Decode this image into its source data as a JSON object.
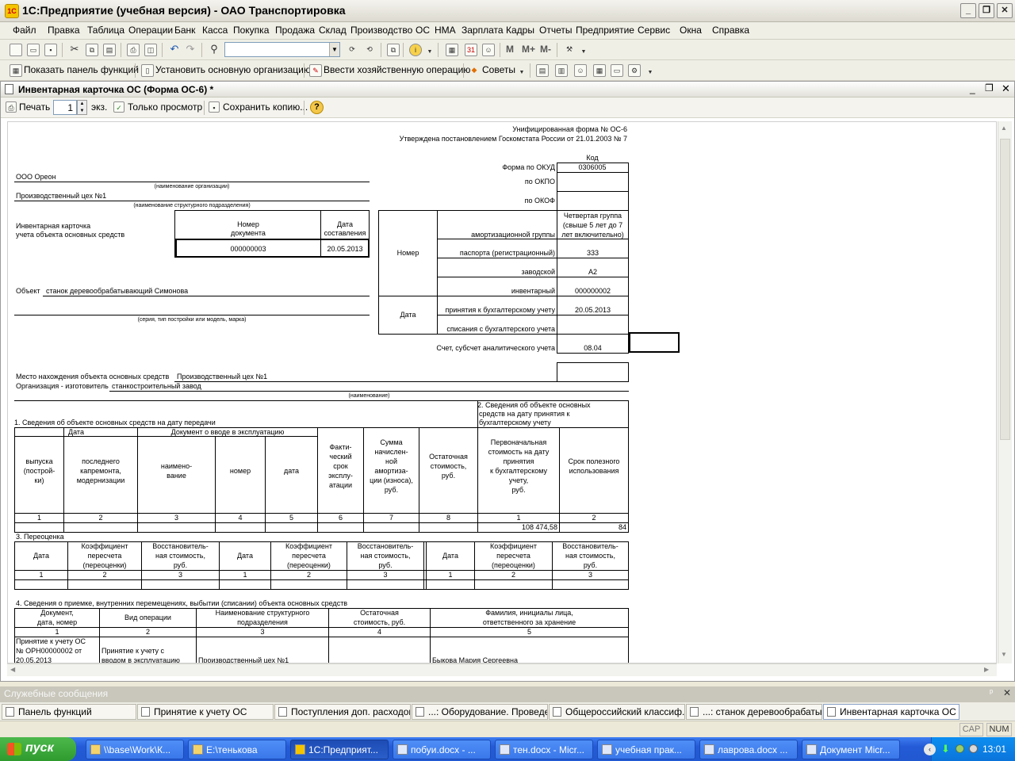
{
  "app": {
    "title": "1С:Предприятие (учебная версия) - ОАО Транспортировка",
    "logo": "1С"
  },
  "menu": [
    "Файл",
    "Правка",
    "Таблица",
    "Операции",
    "Банк",
    "Касса",
    "Покупка",
    "Продажа",
    "Склад",
    "Производство",
    "ОС",
    "НМА",
    "Зарплата",
    "Кадры",
    "Отчеты",
    "Предприятие",
    "Сервис",
    "Окна",
    "Справка"
  ],
  "toolbar2": {
    "panel": "Показать панель функций",
    "org": "Установить основную организацию",
    "op": "Ввести хозяйственную операцию",
    "tips": "Советы",
    "m": "M",
    "mplus": "M+",
    "mminus": "M-"
  },
  "doc": {
    "title": "Инвентарная карточка ОС (Форма ОС-6) *",
    "print": "Печать",
    "copies": "1",
    "copies_unit": "экз.",
    "view_only": "Только просмотр",
    "save_copy": "Сохранить копию...",
    "help": "?"
  },
  "form": {
    "unified": "Унифицированная форма № ОС-6",
    "approved": "Утверждена постановлением Госкомстата России от 21.01.2003 № 7",
    "code": "Код",
    "okud_label": "Форма по ОКУД",
    "okud": "0306005",
    "okpo_label": "по ОКПО",
    "okof_label": "по ОКОФ",
    "org": "ООО Ореон",
    "org_caption": "(наименование организации)",
    "dept": "Производственный цех №1",
    "dept_caption": "(наименование структурного подразделения)",
    "card_title_1": "Инвентарная карточка",
    "card_title_2": "учета объекта основных средств",
    "docnum_h1": "Номер",
    "docnum_h2": "документа",
    "docdate_h1": "Дата",
    "docdate_h2": "составления",
    "docnum": "000000003",
    "docdate": "20.05.2013",
    "number_label": "Номер",
    "date_label": "Дата",
    "amort_group_label": "амортизационной группы",
    "amort_group_1": "Четвертая группа",
    "amort_group_2": "(свыше 5 лет до 7",
    "amort_group_3": "лет включительно)",
    "passport_label": "паспорта (регистрационный)",
    "passport": "333",
    "factory_label": "заводской",
    "factory": "А2",
    "inventory_label": "инвентарный",
    "inventory": "000000002",
    "accept_label": "принятия к бухгалтерскому учету",
    "accept": "20.05.2013",
    "writeoff_label": "списания с бухгалтерского учета",
    "account_label": "Счет, субсчет аналитического учета",
    "account": "08.04",
    "object_label": "Объект",
    "object": "станок деревообрабатывающий Симонова",
    "series_caption": "(серия, тип постройки или модель, марка)",
    "location_label": "Место нахождения объекта основных средств",
    "location": "Производственный цех №1",
    "maker_label": "Организация - изготовитель",
    "maker": "станкостроительный завод",
    "name_caption": "(наименование)",
    "s1_title": "1. Сведения об объекте основных средств на дату передачи",
    "s2_title_1": "2. Сведения об объекте основных",
    "s2_title_2": "средств на дату принятия к",
    "s2_title_3": "бухгалтерскому учету",
    "h_date": "Дата",
    "h_doc": "Документ о вводе в эксплуатацию",
    "h_release_1": "выпуска",
    "h_release_2": "(построй-",
    "h_release_3": "ки)",
    "h_repair_1": "последнего",
    "h_repair_2": "капремонта,",
    "h_repair_3": "модернизации",
    "h_name_1": "наимено-",
    "h_name_2": "вание",
    "h_num": "номер",
    "h_dt": "дата",
    "h_fact_1": "Факти-",
    "h_fact_2": "ческий",
    "h_fact_3": "срок",
    "h_fact_4": "эксплу-",
    "h_fact_5": "атации",
    "h_sum_1": "Сумма",
    "h_sum_2": "начислен-",
    "h_sum_3": "ной",
    "h_sum_4": "амортиза-",
    "h_sum_5": "ции (износа),",
    "h_sum_6": "руб.",
    "h_resid_1": "Остаточная",
    "h_resid_2": "стоимость,",
    "h_resid_3": "руб.",
    "h_init_1": "Первоначальная",
    "h_init_2": "стоимость на дату",
    "h_init_3": "принятия",
    "h_init_4": "к бухгалтерскому",
    "h_init_5": "учету,",
    "h_init_6": "руб.",
    "h_term_1": "Срок полезного",
    "h_term_2": "использования",
    "n1": "1",
    "n2": "2",
    "n3": "3",
    "n4": "4",
    "n5": "5",
    "n6": "6",
    "n7": "7",
    "n8": "8",
    "init_cost": "108 474,58",
    "term": "84",
    "s3_title": "3. Переоценка",
    "r_date": "Дата",
    "r_coef_1": "Коэффициент",
    "r_coef_2": "пересчета",
    "r_coef_3": "(переоценки)",
    "r_rest_1": "Восстановитель-",
    "r_rest_2": "ная стоимость,",
    "r_rest_3": "руб.",
    "s4_title": "4. Сведения о приемке, внутренних перемещениях, выбытии (списании) объекта основных средств",
    "m_doc_1": "Документ,",
    "m_doc_2": "дата, номер",
    "m_op": "Вид операции",
    "m_unit_1": "Наименование структурного",
    "m_unit_2": "подразделения",
    "m_resid_1": "Остаточная",
    "m_resid_2": "стоимость, руб.",
    "m_person_1": "Фамилия, инициалы лица,",
    "m_person_2": "ответственного за хранение",
    "row_doc_1": "Принятие к учету  ОС",
    "row_doc_2": "№ ОРН00000002 от",
    "row_doc_3": "20.05.2013",
    "row_op_1": "Принятие к учету с",
    "row_op_2": "вводом в эксплуатацию",
    "row_unit": "Производственный цех №1",
    "row_person": "Быкова Мария  Сергеевна"
  },
  "service": {
    "title": "Служебные сообщения"
  },
  "windows": [
    "Панель функций",
    "Принятие к учету ОС",
    "Поступления доп. расходов",
    "...: Оборудование. Проведен",
    "Общероссийский классиф...",
    "...: станок деревообрабаты...",
    "Инвентарная карточка ОС (..."
  ],
  "status": {
    "cap": "CAP",
    "num": "NUM"
  },
  "taskbar": {
    "start": "пуск",
    "items": [
      "\\\\base\\Work\\К...",
      "E:\\тенькова",
      "1С:Предприят...",
      "побуи.docx - ...",
      "тен.docx - Micr...",
      "учебная прак...",
      "лаврова.docx ...",
      "Документ Micr..."
    ],
    "clock": "13:01"
  }
}
